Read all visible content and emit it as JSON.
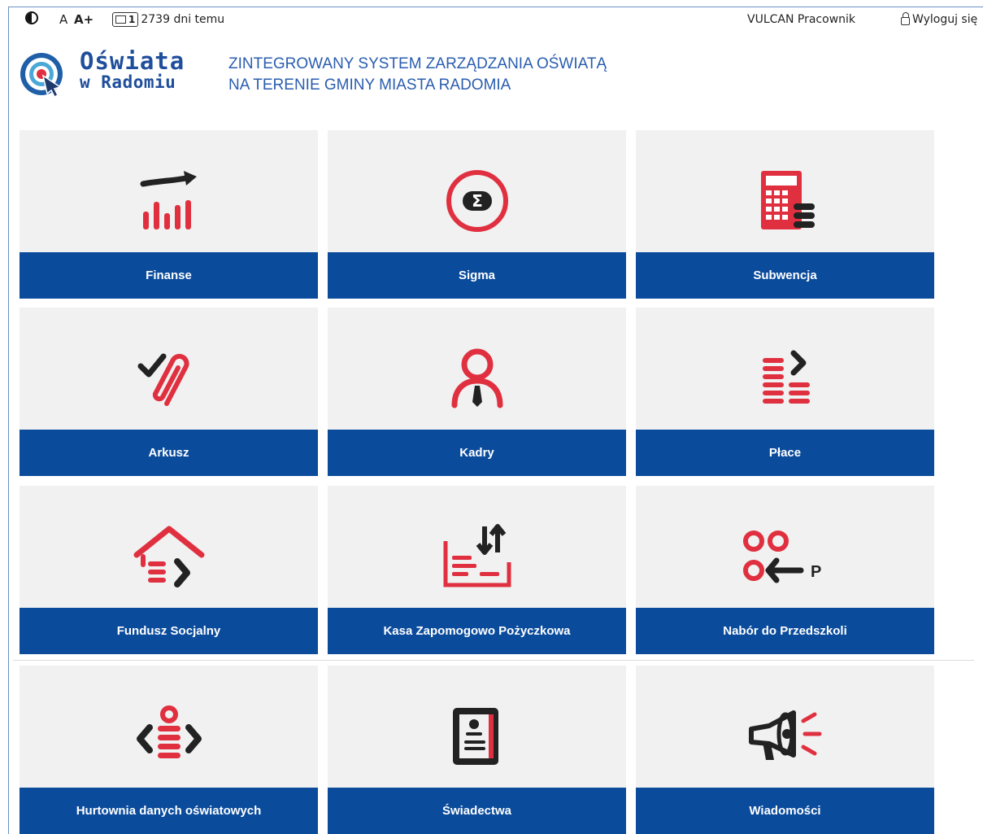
{
  "topbar": {
    "font_small": "A",
    "font_large": "A+",
    "messages_count": "1",
    "last_login": "2739 dni temu",
    "user": "VULCAN Pracownik",
    "logout": "Wyloguj się"
  },
  "header": {
    "brand_line1": "Oświata",
    "brand_line2": "w Radomiu",
    "headline_line1": "ZINTEGROWANY SYSTEM ZARZĄDZANIA OŚWIATĄ",
    "headline_line2": "NA TERENIE GMINY MIASTA RADOMIA"
  },
  "tiles": [
    {
      "label": "Finanse",
      "icon": "finance-chart-icon"
    },
    {
      "label": "Sigma",
      "icon": "sigma-icon"
    },
    {
      "label": "Subwencja",
      "icon": "calculator-icon"
    },
    {
      "label": "Arkusz",
      "icon": "paperclip-check-icon"
    },
    {
      "label": "Kadry",
      "icon": "person-tie-icon"
    },
    {
      "label": "Płace",
      "icon": "coins-arrow-icon"
    },
    {
      "label": "Fundusz Socjalny",
      "icon": "house-list-icon"
    },
    {
      "label": "Kasa Zapomogowo Pożyczkowa",
      "icon": "cash-transfer-icon"
    },
    {
      "label": "Nabór do Przedszkoli",
      "icon": "preschool-enrollment-icon"
    },
    {
      "label": "Hurtownia danych oświatowych",
      "icon": "data-warehouse-icon"
    },
    {
      "label": "Świadectwa",
      "icon": "certificate-icon"
    },
    {
      "label": "Wiadomości",
      "icon": "megaphone-icon"
    }
  ],
  "colors": {
    "accent_blue": "#0a4b9c",
    "icon_red": "#e03040",
    "icon_dark": "#222222",
    "tile_bg": "#f1f1f1"
  }
}
